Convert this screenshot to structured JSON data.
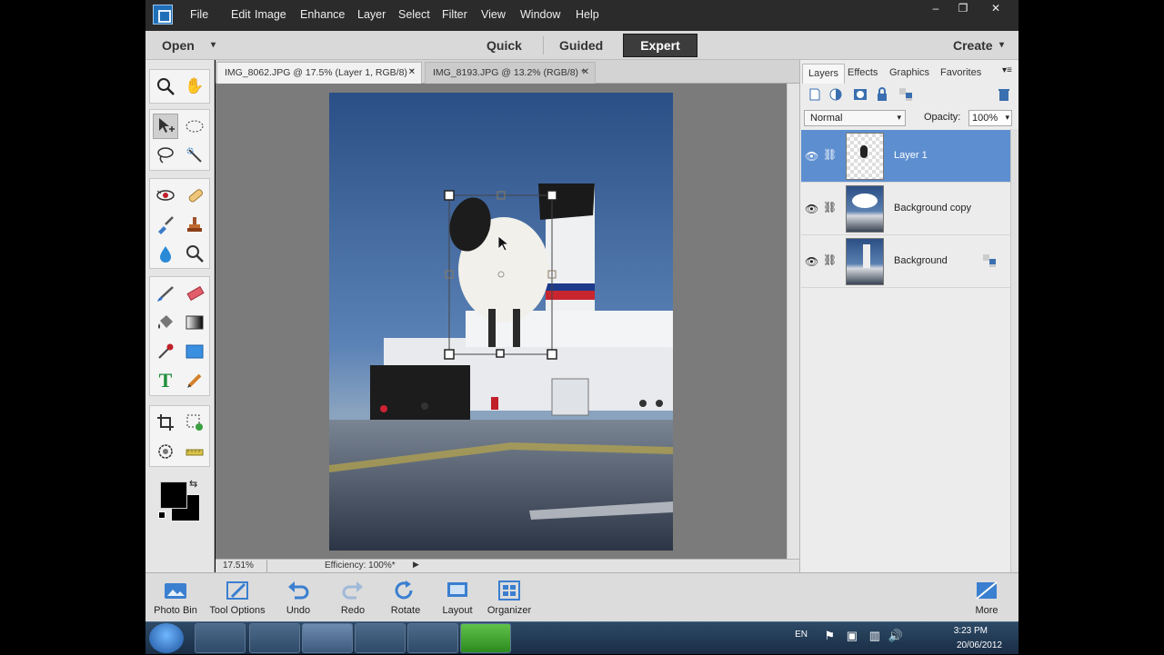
{
  "app": {
    "menu": [
      "File",
      "Edit",
      "Image",
      "Enhance",
      "Layer",
      "Select",
      "Filter",
      "View",
      "Window",
      "Help"
    ],
    "window_controls": [
      "–",
      "❐",
      "✕"
    ]
  },
  "modebar": {
    "open_label": "Open",
    "modes": [
      "Quick",
      "Guided",
      "Expert"
    ],
    "active_mode": "Expert",
    "create_label": "Create"
  },
  "tabs": [
    {
      "label": "IMG_8062.JPG @ 17.5% (Layer 1, RGB/8) *",
      "active": true
    },
    {
      "label": "IMG_8193.JPG @ 13.2% (RGB/8) *",
      "active": false
    }
  ],
  "status": {
    "zoom": "17.51%",
    "info": "Efficiency: 100%*"
  },
  "panel": {
    "tabs": [
      "Layers",
      "Effects",
      "Graphics",
      "Favorites"
    ],
    "blend_mode": "Normal",
    "opacity_label": "Opacity:",
    "opacity_value": "100%",
    "layers": [
      {
        "name": "Layer 1",
        "selected": true
      },
      {
        "name": "Background copy",
        "selected": false
      },
      {
        "name": "Background",
        "selected": false
      }
    ]
  },
  "bottom": {
    "buttons": [
      "Photo Bin",
      "Tool Options",
      "Undo",
      "Redo",
      "Rotate",
      "Layout",
      "Organizer"
    ],
    "more_label": "More"
  },
  "tray": {
    "lang": "EN",
    "time": "3:23 PM",
    "date": "20/06/2012"
  },
  "colors": {
    "accent": "#5d8fd0",
    "menubar": "#2b2b2b",
    "expert_button": "#3c3c3c"
  }
}
